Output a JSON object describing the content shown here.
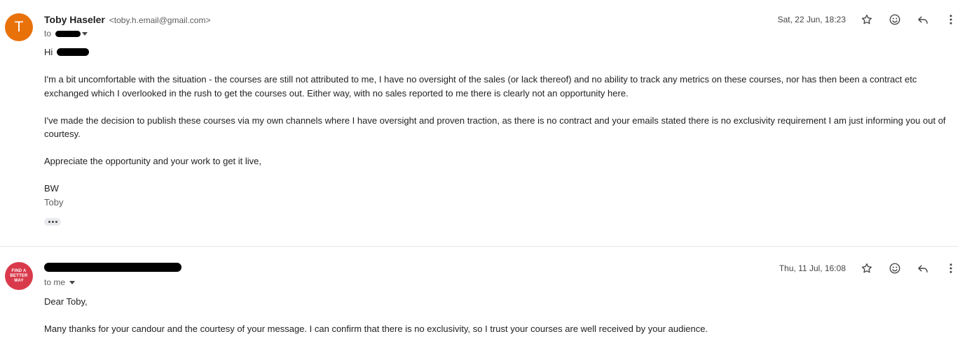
{
  "messages": [
    {
      "avatar_letter": "T",
      "sender_name": "Toby Haseler",
      "sender_email": "<toby.h.email@gmail.com>",
      "to_prefix": "to",
      "date": "Sat, 22 Jun, 18:23",
      "greeting": "Hi",
      "paragraphs": [
        "I'm a bit uncomfortable with the situation - the courses are still not attributed to me, I have no oversight of the sales (or lack thereof) and no ability to track any metrics on these courses, nor has then been a contract etc exchanged which I overlooked in the rush to get the courses out. Either way, with no sales reported to me there is clearly not an opportunity here.",
        "I've made the decision to publish these courses via my own channels where I have oversight and proven traction, as there is no contract and your emails stated there is no exclusivity requirement I am just informing you out of courtesy.",
        "Appreciate the opportunity and your work to get it live,"
      ],
      "signoff": "BW",
      "signature": "Toby"
    },
    {
      "avatar_text": [
        "FIND A",
        "BETTER",
        "WAY"
      ],
      "to_label": "to me",
      "date": "Thu, 11 Jul, 16:08",
      "greeting": "Dear Toby,",
      "paragraphs": [
        "Many thanks for your candour and the courtesy of your message. I can confirm that there is no exclusivity, so I trust your courses are well received by your audience."
      ]
    }
  ],
  "icons": {
    "star": "star-icon",
    "emoji": "emoji-icon",
    "reply": "reply-icon",
    "more": "more-vert-icon",
    "caret": "caret-down-icon"
  },
  "colors": {
    "avatar_t": "#e8710a",
    "avatar_logo": "#d93a4b",
    "text": "#1f1f1f",
    "muted": "#5e5e5e"
  }
}
